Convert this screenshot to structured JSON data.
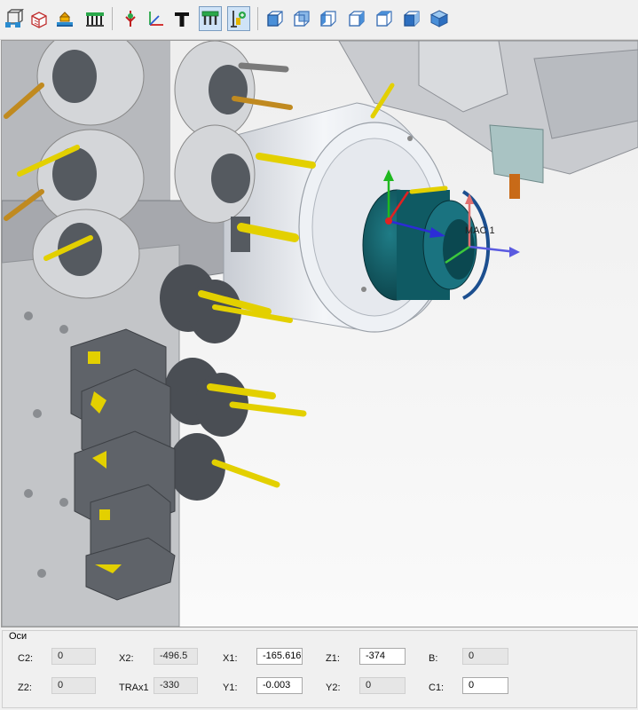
{
  "toolbar": {
    "buttons": [
      {
        "icon": "network-cube-icon"
      },
      {
        "icon": "red-cube-icon"
      },
      {
        "icon": "workpiece-icon"
      },
      {
        "icon": "fixture-icon"
      },
      {
        "icon": "pin-marker-icon"
      },
      {
        "icon": "axes-icon"
      },
      {
        "icon": "text-t-icon"
      },
      {
        "icon": "clamp-tool-icon",
        "active": true
      },
      {
        "icon": "machine-tool-icon",
        "active": true
      },
      {
        "icon": "view-cube-front-icon"
      },
      {
        "icon": "view-cube-back-icon"
      },
      {
        "icon": "view-cube-left-icon"
      },
      {
        "icon": "view-cube-right-icon"
      },
      {
        "icon": "view-cube-top-icon"
      },
      {
        "icon": "view-cube-bottom-icon"
      },
      {
        "icon": "view-cube-iso-icon"
      }
    ]
  },
  "viewport": {
    "label": "MAC 1",
    "colors": {
      "spindle": "#0f5a63",
      "tool": "#e3d000",
      "axis_x": "#2c2cd6",
      "axis_y": "#1fb81f",
      "axis_z": "#e02222"
    }
  },
  "axes_panel": {
    "title": "Оси",
    "rows": [
      [
        {
          "label": "C2:",
          "value": "0",
          "editable": false
        },
        {
          "label": "X2:",
          "value": "-496.5",
          "editable": false
        },
        {
          "label": "X1:",
          "value": "-165.616",
          "editable": true
        },
        {
          "label": "Z1:",
          "value": "-374",
          "editable": true
        },
        {
          "label": "B:",
          "value": "0",
          "editable": false
        }
      ],
      [
        {
          "label": "Z2:",
          "value": "0",
          "editable": false
        },
        {
          "label": "TRAx1",
          "value": "-330",
          "editable": false
        },
        {
          "label": "Y1:",
          "value": "-0.003",
          "editable": true
        },
        {
          "label": "Y2:",
          "value": "0",
          "editable": false
        },
        {
          "label": "C1:",
          "value": "0",
          "editable": true
        }
      ]
    ]
  }
}
